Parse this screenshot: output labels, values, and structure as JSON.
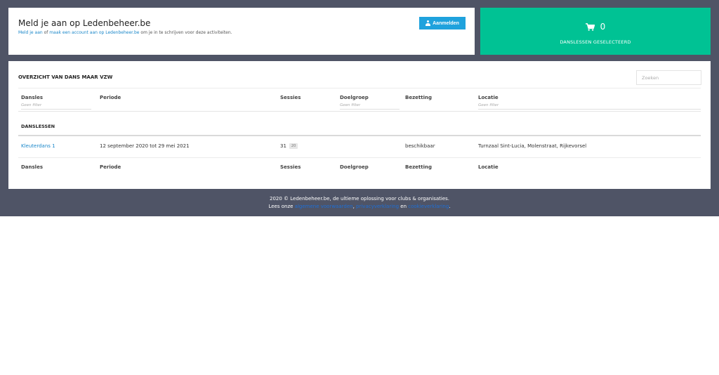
{
  "login": {
    "title": "Meld je aan op Ledenbeheer.be",
    "link_login": "Meld je aan",
    "text_or": " of ",
    "link_create": "maak een account aan op Ledenbeheer.be",
    "text_rest": " om je in te schrijven voor deze activiteiten.",
    "button_label": "Aanmelden"
  },
  "cart": {
    "count": "0",
    "label": "DANSLESSEN GESELECTEERD"
  },
  "overview": {
    "title": "OVERZICHT VAN DANS MAAR VZW",
    "search_placeholder": "Zoeken"
  },
  "table": {
    "columns": [
      "Dansles",
      "Periode",
      "Sessies",
      "Doelgroep",
      "Bezetting",
      "Locatie"
    ],
    "filter_placeholder": "Geen filter",
    "section": "DANSLESSEN",
    "rows": [
      {
        "dansles": "Kleuterdans 1",
        "periode": "12 september 2020 tot 29 mei 2021",
        "sessies": "31",
        "sessies_badge": "20",
        "doelgroep": "",
        "bezetting": "beschikbaar",
        "locatie": "Turnzaal Sint-Lucia, Molenstraat, Rijkevorsel"
      }
    ]
  },
  "footer": {
    "line1": "2020 © Ledenbeheer.be, de ultieme oplossing voor clubs & organisaties.",
    "lees": "Lees onze ",
    "link1": "algemene voorwaarden",
    "sep1": ", ",
    "link2": "privacyverklaring",
    "sep2": " en ",
    "link3": "cookieverklaring",
    "end": "."
  },
  "colors": {
    "backdrop": "#4f5466",
    "accent_green": "#00c294",
    "button_blue": "#1fa2dd",
    "link_blue": "#1a87c9"
  }
}
